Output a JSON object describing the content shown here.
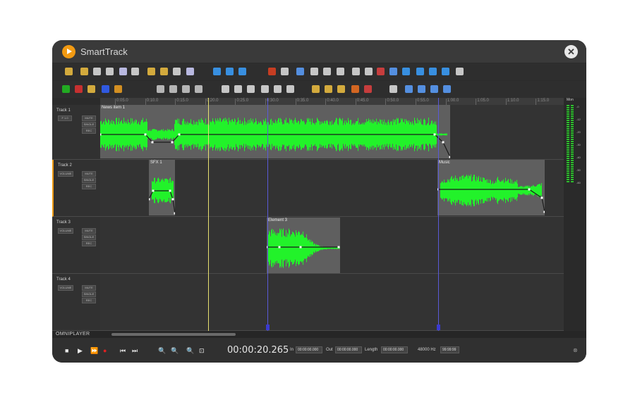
{
  "app": {
    "title": "SmartTrack"
  },
  "ruler": {
    "ticks": [
      "0:05.0",
      "0:10.0",
      "0:15.0",
      "0:20.0",
      "0:25.0",
      "0:30.0",
      "0:35.0",
      "0:40.0",
      "0:45.0",
      "0:50.0",
      "0:55.0",
      "1:00.0",
      "1:05.0",
      "1:10.0",
      "1:15.0"
    ]
  },
  "tracks": [
    {
      "name": "Track 1",
      "main_button": "F 1.0",
      "buttons": [
        "MUTE",
        "SINGLE",
        "REC"
      ],
      "clips": [
        {
          "label": "News item 1"
        }
      ]
    },
    {
      "name": "Track 2",
      "main_button": "VOLUME",
      "buttons": [
        "MUTE",
        "SINGLE",
        "REC"
      ],
      "clips": [
        {
          "label": "SFX 1"
        },
        {
          "label": "Music"
        }
      ]
    },
    {
      "name": "Track 3",
      "main_button": "VOLUME",
      "buttons": [
        "MUTE",
        "SINGLE",
        "REC"
      ],
      "clips": [
        {
          "label": "Element 3"
        }
      ]
    },
    {
      "name": "Track 4",
      "main_button": "VOLUME",
      "buttons": [
        "MUTE",
        "SINGLE",
        "REC"
      ],
      "clips": []
    }
  ],
  "meter": {
    "label": "Mon",
    "scale": [
      "-0",
      "-12",
      "-20",
      "-30",
      "-40",
      "-50",
      "-60"
    ]
  },
  "footer": {
    "brand": "OMNIPLAYER"
  },
  "transport": {
    "timecode": "00:00:20.265",
    "in_label": "In",
    "in_value": "00:00:00.000",
    "out_label": "Out",
    "out_value": "00:00:00.000",
    "length_label": "Length",
    "length_value": "00:00:00.000",
    "sample_rate": "48000 Hz",
    "counter": "99:99:99"
  },
  "colors": {
    "accent": "#f29a12",
    "waveform": "#22f22a",
    "playhead": "#e8e070",
    "marker": "#5a5ad8"
  }
}
